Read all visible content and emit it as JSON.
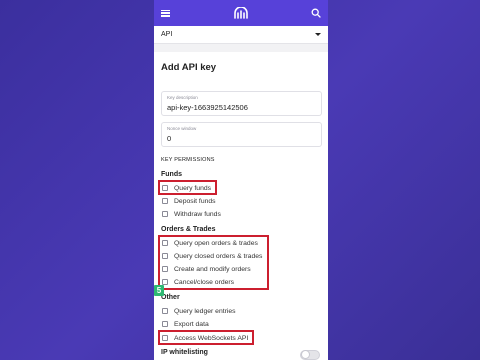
{
  "header": {
    "menu_icon": "hamburger-icon",
    "logo_icon": "kraken-logo-icon",
    "search_icon": "search-icon"
  },
  "selector": {
    "value": "API"
  },
  "form": {
    "title": "Add API key",
    "key_description": {
      "label": "Key description",
      "value": "api-key-1663925142506"
    },
    "nonce_window": {
      "label": "Nonce window",
      "value": "0"
    },
    "permissions_heading": "KEY PERMISSIONS",
    "groups": [
      {
        "name": "Funds",
        "items": [
          "Query funds",
          "Deposit funds",
          "Withdraw funds"
        ]
      },
      {
        "name": "Orders & Trades",
        "items": [
          "Query open orders & trades",
          "Query closed orders & trades",
          "Create and modify orders",
          "Cancel/close orders"
        ]
      },
      {
        "name": "Other",
        "items": [
          "Query ledger entries",
          "Export data",
          "Access WebSockets API"
        ]
      }
    ],
    "ip_whitelisting": "IP whitelisting"
  },
  "step_badge": "5",
  "colors": {
    "brand": "#5741d9",
    "highlight": "#cc1f2f",
    "badge": "#2eb872"
  }
}
